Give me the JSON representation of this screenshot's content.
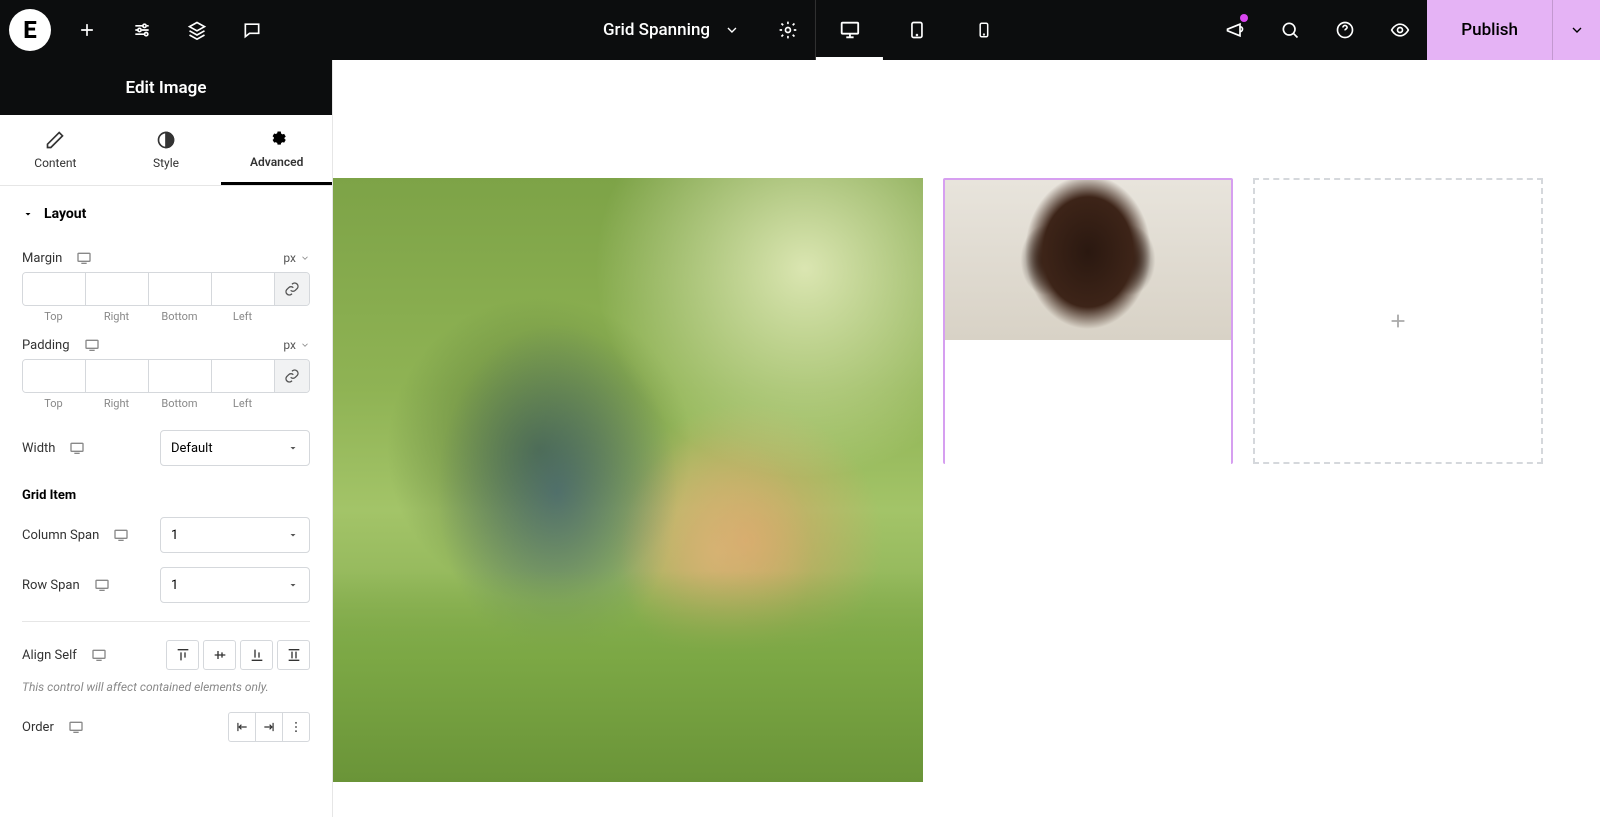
{
  "topbar": {
    "page_title": "Grid Spanning",
    "publish_label": "Publish"
  },
  "panel": {
    "header": "Edit Image",
    "tabs": {
      "content": "Content",
      "style": "Style",
      "advanced": "Advanced"
    },
    "layout": {
      "section_title": "Layout",
      "margin_label": "Margin",
      "padding_label": "Padding",
      "unit": "px",
      "dims": {
        "top": "Top",
        "right": "Right",
        "bottom": "Bottom",
        "left": "Left"
      },
      "margin_values": {
        "top": "",
        "right": "",
        "bottom": "",
        "left": ""
      },
      "padding_values": {
        "top": "",
        "right": "",
        "bottom": "",
        "left": ""
      },
      "width_label": "Width",
      "width_value": "Default"
    },
    "grid_item": {
      "heading": "Grid Item",
      "column_span_label": "Column Span",
      "column_span_value": "1",
      "row_span_label": "Row Span",
      "row_span_value": "1",
      "align_self_label": "Align Self",
      "hint": "This control will affect contained elements only.",
      "order_label": "Order"
    }
  },
  "icons": {
    "add": "add-icon",
    "tune": "tune-icon",
    "layers": "layers-icon",
    "comment": "comment-icon",
    "chevron_down": "chevron-down-icon",
    "settings": "settings-icon",
    "desktop": "desktop-icon",
    "tablet": "tablet-icon",
    "mobile": "mobile-icon",
    "announce": "announce-icon",
    "search": "search-icon",
    "help": "help-icon",
    "preview": "preview-icon",
    "pencil": "pencil-icon",
    "contrast": "contrast-icon",
    "gear": "gear-icon",
    "caret": "caret-down-icon",
    "link": "link-icon",
    "responsive": "responsive-icon",
    "plus": "plus-icon"
  }
}
